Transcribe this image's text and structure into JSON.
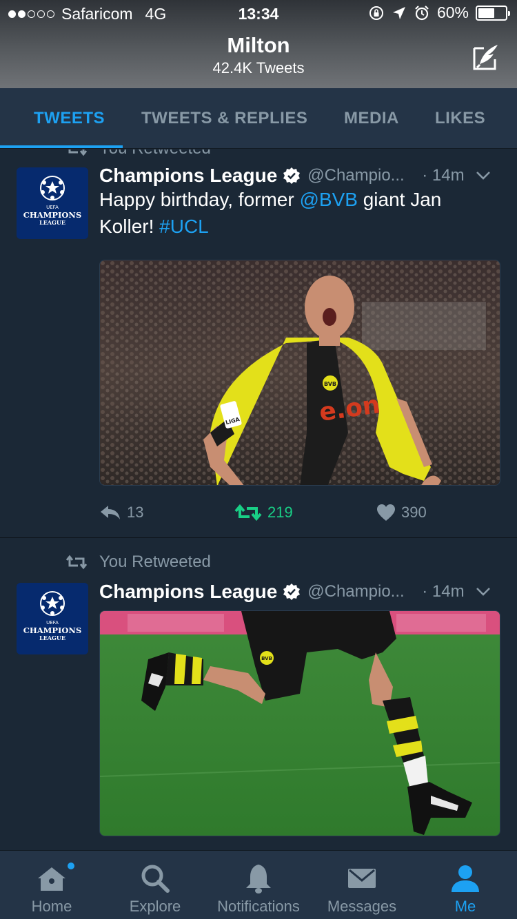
{
  "status_bar": {
    "carrier": "Safaricom",
    "network": "4G",
    "time": "13:34",
    "battery_percent": "60%",
    "battery_level": 0.6,
    "signal_bars": 2,
    "icons": [
      "rotation-lock-icon",
      "location-arrow-icon",
      "alarm-clock-icon",
      "battery-icon"
    ]
  },
  "profile": {
    "name": "Milton",
    "tweet_count": "42.4K Tweets"
  },
  "tabs": [
    {
      "label": "TWEETS",
      "active": true
    },
    {
      "label": "TWEETS & REPLIES",
      "active": false
    },
    {
      "label": "MEDIA",
      "active": false
    },
    {
      "label": "LIKES",
      "active": false
    }
  ],
  "tweets": [
    {
      "retweet_label": "You Retweeted",
      "avatar_text": "CHAMPIONS",
      "avatar_subtext": "LEAGUE",
      "avatar_uefa": "UEFA",
      "name": "Champions League",
      "handle": "@Champio...",
      "time": "· 14m",
      "text_parts": [
        {
          "text": "Happy birthday, former ",
          "type": "text"
        },
        {
          "text": "@BVB",
          "type": "mention"
        },
        {
          "text": " giant Jan Koller! ",
          "type": "text"
        },
        {
          "text": "#UCL",
          "type": "hashtag"
        }
      ],
      "image_sponsor": "e.on",
      "image_badge": "BVB",
      "image_patch": "LIGA",
      "replies": "13",
      "retweets": "219",
      "likes": "390",
      "retweeted": true
    },
    {
      "retweet_label": "You Retweeted",
      "avatar_text": "CHAMPIONS",
      "avatar_subtext": "LEAGUE",
      "avatar_uefa": "UEFA",
      "name": "Champions League",
      "handle": "@Champio...",
      "time": "· 14m",
      "image_badge": "BVB"
    }
  ],
  "tabbar": [
    {
      "label": "Home",
      "icon": "home-icon",
      "active": false,
      "has_badge": true
    },
    {
      "label": "Explore",
      "icon": "search-icon",
      "active": false
    },
    {
      "label": "Notifications",
      "icon": "bell-icon",
      "active": false
    },
    {
      "label": "Messages",
      "icon": "envelope-icon",
      "active": false
    },
    {
      "label": "Me",
      "icon": "person-icon",
      "active": true
    }
  ],
  "colors": {
    "accent": "#1da1f2",
    "background": "#1b2836",
    "bar": "#243447",
    "muted": "#8899a6",
    "retweet_green": "#19cf86"
  }
}
